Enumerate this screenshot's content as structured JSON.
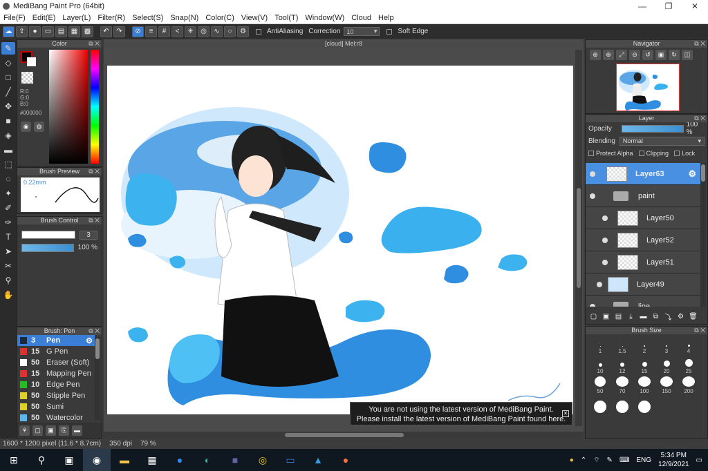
{
  "window": {
    "title": "MediBang Paint Pro (64bit)",
    "minimize": "—",
    "maximize": "❐",
    "close": "✕"
  },
  "menu": [
    "File(F)",
    "Edit(E)",
    "Layer(L)",
    "Filter(R)",
    "Select(S)",
    "Snap(N)",
    "Color(C)",
    "View(V)",
    "Tool(T)",
    "Window(W)",
    "Cloud",
    "Help"
  ],
  "toolbar": {
    "antialiasing_label": "AntiAliasing",
    "correction_label": "Correction",
    "correction_value": "10",
    "soft_edge_label": "Soft Edge"
  },
  "color_panel": {
    "title": "Color",
    "r": "R:0",
    "g": "G:0",
    "b": "B:0",
    "hex": "#000000",
    "foreground": "#000000",
    "background": "#ffffff"
  },
  "brush_preview": {
    "title": "Brush Preview",
    "size": "0.22mm"
  },
  "brush_control": {
    "title": "Brush Control",
    "size_value": "3",
    "opacity_value": "100 %"
  },
  "brush_list": {
    "title": "Brush: Pen",
    "items": [
      {
        "num": "3",
        "name": "Pen",
        "color": "#3a7fd5"
      },
      {
        "num": "15",
        "name": "G Pen",
        "color": "#e03030"
      },
      {
        "num": "50",
        "name": "Eraser (Soft)",
        "color": "#ffffff"
      },
      {
        "num": "15",
        "name": "Mapping Pen",
        "color": "#e03030"
      },
      {
        "num": "10",
        "name": "Edge Pen",
        "color": "#20c020"
      },
      {
        "num": "50",
        "name": "Stipple Pen",
        "color": "#e0d020"
      },
      {
        "num": "50",
        "name": "Sumi",
        "color": "#e0d020"
      },
      {
        "num": "50",
        "name": "Watercolor",
        "color": "#5ab8f0"
      }
    ]
  },
  "canvas": {
    "tab_title": "[cloud] Mel:r8",
    "notice_line1": "You are not using the latest version of MediBang Paint.",
    "notice_line2": "Please install the latest version of MediBang Paint found here."
  },
  "status": {
    "dimensions": "1600 * 1200 pixel",
    "physical": "(11.6 * 8.7cm)",
    "dpi": "350 dpi",
    "zoom": "79 %"
  },
  "navigator": {
    "title": "Navigator"
  },
  "layer_panel": {
    "title": "Layer",
    "opacity_label": "Opacity",
    "opacity_value": "100 %",
    "blending_label": "Blending",
    "blending_value": "Normal",
    "protect_alpha": "Protect Alpha",
    "clipping": "Clipping",
    "lock": "Lock",
    "layers": [
      {
        "name": "Layer63",
        "type": "layer",
        "indent": 0,
        "selected": true
      },
      {
        "name": "paint",
        "type": "folder",
        "indent": 0,
        "selected": false
      },
      {
        "name": "Layer50",
        "type": "layer",
        "indent": 1,
        "selected": false
      },
      {
        "name": "Layer52",
        "type": "layer",
        "indent": 1,
        "selected": false
      },
      {
        "name": "Layer51",
        "type": "layer",
        "indent": 1,
        "selected": false
      },
      {
        "name": "Layer49",
        "type": "layer",
        "indent": 0,
        "selected": false
      },
      {
        "name": "line",
        "type": "folder",
        "indent": 0,
        "selected": false
      }
    ]
  },
  "brush_size": {
    "title": "Brush Size",
    "sizes": [
      "1",
      "1.5",
      "2",
      "3",
      "4",
      "10",
      "12",
      "15",
      "20",
      "25",
      "50",
      "70",
      "100",
      "150",
      "200",
      "",
      "",
      ""
    ]
  },
  "taskbar": {
    "language": "ENG",
    "time": "5:34 PM",
    "date": "12/9/2021"
  }
}
